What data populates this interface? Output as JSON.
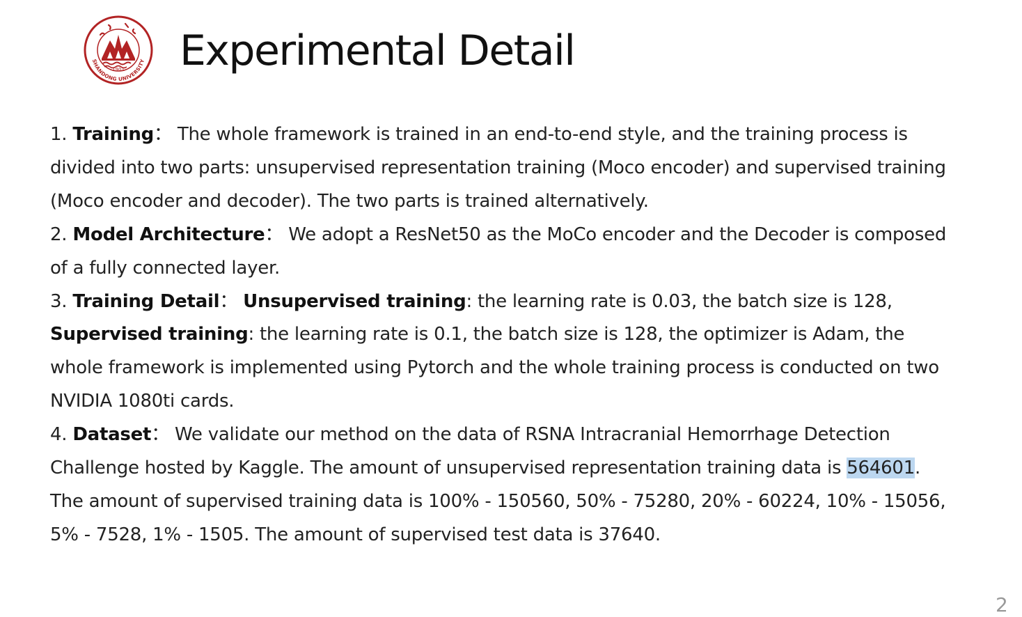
{
  "slide": {
    "title": "Experimental Detail",
    "page_number": "2",
    "logo": {
      "icon": "shandong-university-seal-icon",
      "text_year": "1901",
      "text_name": "SHANDONG UNIVERSITY",
      "color": "#b22324"
    }
  },
  "items": [
    {
      "num": "1.",
      "heading": "Training",
      "sep": "：",
      "body": "The whole framework is trained in an end-to-end style, and the training process is divided into two parts: unsupervised representation training (Moco encoder) and supervised training (Moco encoder and decoder). The two parts is trained alternatively."
    },
    {
      "num": "2.",
      "heading": "Model Architecture",
      "sep": "：",
      "body": "We adopt a ResNet50 as the MoCo encoder and the Decoder is composed of a fully connected layer."
    },
    {
      "num": "3.",
      "heading": "Training Detail",
      "sep": "：",
      "sub1_label": "Unsupervised training",
      "sub1_text": ": the learning rate is 0.03, the batch size is 128,",
      "sub2_label": "Supervised training",
      "sub2_text": ": the learning rate is 0.1, the batch size is 128, the optimizer is Adam, the whole framework is implemented using Pytorch and the whole training process is conducted on two NVIDIA 1080ti cards."
    },
    {
      "num": "4.",
      "heading": "Dataset",
      "sep": "：",
      "body_before": "We validate our method on the data of RSNA Intracranial Hemorrhage Detection Challenge hosted by Kaggle. The amount of unsupervised representation training data is ",
      "highlight": "564601",
      "body_after": ". The amount of supervised training data is 100% - 150560, 50% - 75280, 20% - 60224, 10% - 15056, 5% - 7528, 1% - 1505. The amount of supervised test data is 37640.",
      "highlight_color": "#bcd7f0"
    }
  ]
}
